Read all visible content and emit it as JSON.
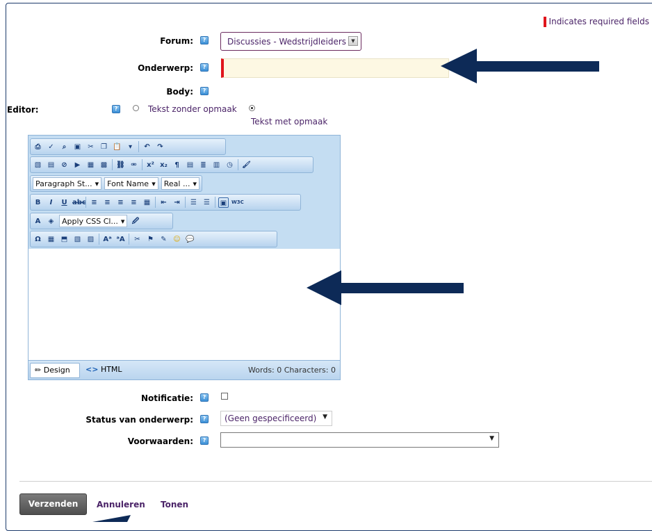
{
  "header": {
    "required_note": "Indicates required fields"
  },
  "form": {
    "forum_label": "Forum:",
    "forum_value": "Discussies - Wedstrijdleiders",
    "subject_label": "Onderwerp:",
    "subject_value": "",
    "body_label": "Body:",
    "editor_label": "Editor:",
    "editor_options": [
      "Tekst zonder opmaak",
      "Tekst met opmaak"
    ],
    "editor_selected": "Tekst met opmaak",
    "notification_label": "Notificatie:",
    "notification_checked": false,
    "status_label": "Status van onderwerp:",
    "status_value": "(Geen gespecificeerd)",
    "conditions_label": "Voorwaarden:",
    "conditions_value": ""
  },
  "editor": {
    "paragraph_style": "Paragraph St...",
    "font_name": "Font Name",
    "font_size": "Real ...",
    "css_class": "Apply CSS Cl...",
    "mode_design": "Design",
    "mode_html": "HTML",
    "word_count": "Words: 0   Characters: 0"
  },
  "actions": {
    "submit": "Verzenden",
    "cancel": "Annuleren",
    "preview": "Tonen"
  },
  "colors": {
    "arrow": "#0d2a57",
    "required": "#e0151c",
    "link": "#4b2468"
  }
}
